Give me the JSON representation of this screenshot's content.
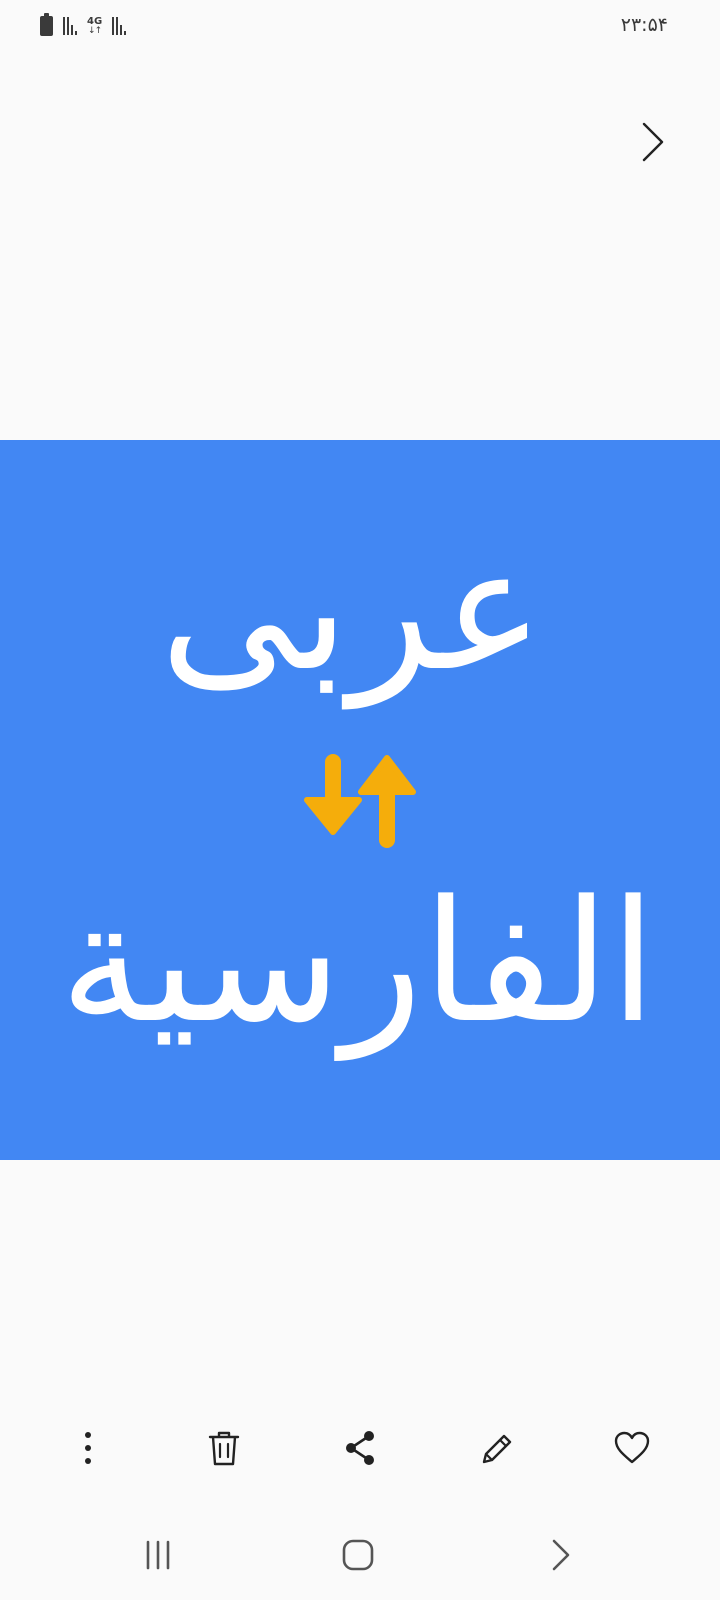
{
  "status_bar": {
    "time": "۲۳:۵۴",
    "network_type": "4G",
    "network_arrows": "↓↑",
    "icons": [
      "battery-icon",
      "signal-icon",
      "network-4g-icon",
      "signal-icon"
    ]
  },
  "viewer": {
    "next_icon": "chevron-right-icon",
    "image": {
      "background_color": "#4287f3",
      "text_top": "عربی",
      "text_bottom": "الفارسية",
      "text_color": "#ffffff",
      "arrow_color": "#f5ad0b",
      "arrow_icon": "swap-vertical-icon"
    }
  },
  "action_bar": {
    "items": [
      {
        "name": "more-options",
        "icon": "more-vertical-icon"
      },
      {
        "name": "delete",
        "icon": "trash-icon"
      },
      {
        "name": "share",
        "icon": "share-icon"
      },
      {
        "name": "edit",
        "icon": "pencil-icon"
      },
      {
        "name": "favorite",
        "icon": "heart-icon"
      }
    ]
  },
  "nav_bar": {
    "items": [
      {
        "name": "recents",
        "icon": "recents-icon"
      },
      {
        "name": "home",
        "icon": "home-icon"
      },
      {
        "name": "back",
        "icon": "back-icon"
      }
    ]
  }
}
